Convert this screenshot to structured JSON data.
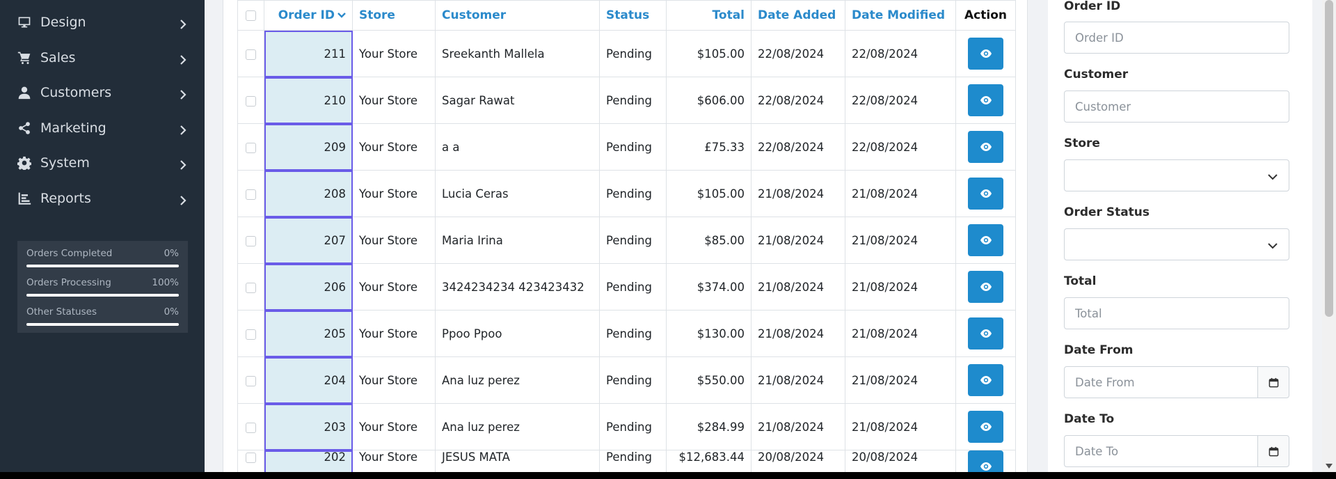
{
  "sidebar": {
    "items": [
      {
        "label": "Design",
        "icon": "monitor-icon"
      },
      {
        "label": "Sales",
        "icon": "cart-icon"
      },
      {
        "label": "Customers",
        "icon": "user-icon"
      },
      {
        "label": "Marketing",
        "icon": "share-icon"
      },
      {
        "label": "System",
        "icon": "gear-icon"
      },
      {
        "label": "Reports",
        "icon": "chart-icon"
      }
    ],
    "stats": [
      {
        "label": "Orders Completed",
        "value": "0%",
        "fraction": 1.0
      },
      {
        "label": "Orders Processing",
        "value": "100%",
        "fraction": 1.0
      },
      {
        "label": "Other Statuses",
        "value": "0%",
        "fraction": 1.0
      }
    ]
  },
  "table": {
    "headers": {
      "order_id": "Order ID",
      "store": "Store",
      "customer": "Customer",
      "status": "Status",
      "total": "Total",
      "date_added": "Date Added",
      "date_modified": "Date Modified",
      "action": "Action"
    },
    "rows": [
      {
        "order_id": "211",
        "store": "Your Store",
        "customer": "Sreekanth Mallela",
        "status": "Pending",
        "total": "$105.00",
        "date_added": "22/08/2024",
        "date_modified": "22/08/2024"
      },
      {
        "order_id": "210",
        "store": "Your Store",
        "customer": "Sagar Rawat",
        "status": "Pending",
        "total": "$606.00",
        "date_added": "22/08/2024",
        "date_modified": "22/08/2024"
      },
      {
        "order_id": "209",
        "store": "Your Store",
        "customer": "a a",
        "status": "Pending",
        "total": "£75.33",
        "date_added": "22/08/2024",
        "date_modified": "22/08/2024"
      },
      {
        "order_id": "208",
        "store": "Your Store",
        "customer": "Lucia Ceras",
        "status": "Pending",
        "total": "$105.00",
        "date_added": "21/08/2024",
        "date_modified": "21/08/2024"
      },
      {
        "order_id": "207",
        "store": "Your Store",
        "customer": "Maria Irina",
        "status": "Pending",
        "total": "$85.00",
        "date_added": "21/08/2024",
        "date_modified": "21/08/2024"
      },
      {
        "order_id": "206",
        "store": "Your Store",
        "customer": "3424234234 423423432",
        "status": "Pending",
        "total": "$374.00",
        "date_added": "21/08/2024",
        "date_modified": "21/08/2024"
      },
      {
        "order_id": "205",
        "store": "Your Store",
        "customer": "Ppoo Ppoo",
        "status": "Pending",
        "total": "$130.00",
        "date_added": "21/08/2024",
        "date_modified": "21/08/2024"
      },
      {
        "order_id": "204",
        "store": "Your Store",
        "customer": "Ana luz perez",
        "status": "Pending",
        "total": "$550.00",
        "date_added": "21/08/2024",
        "date_modified": "21/08/2024"
      },
      {
        "order_id": "203",
        "store": "Your Store",
        "customer": "Ana luz perez",
        "status": "Pending",
        "total": "$284.99",
        "date_added": "21/08/2024",
        "date_modified": "21/08/2024"
      },
      {
        "order_id": "202",
        "store": "Your Store",
        "customer": "JESUS MATA",
        "status": "Pending",
        "total": "$12,683.44",
        "date_added": "20/08/2024",
        "date_modified": "20/08/2024"
      }
    ]
  },
  "filters": {
    "order_id": {
      "label": "Order ID",
      "placeholder": "Order ID"
    },
    "customer": {
      "label": "Customer",
      "placeholder": "Customer"
    },
    "store": {
      "label": "Store",
      "value": ""
    },
    "order_status": {
      "label": "Order Status",
      "value": ""
    },
    "total": {
      "label": "Total",
      "placeholder": "Total"
    },
    "date_from": {
      "label": "Date From",
      "placeholder": "Date From"
    },
    "date_to": {
      "label": "Date To",
      "placeholder": "Date To"
    }
  },
  "colors": {
    "sidebar_bg": "#222d39",
    "accent": "#1e8bcd",
    "selection": "#6a5ce8"
  }
}
